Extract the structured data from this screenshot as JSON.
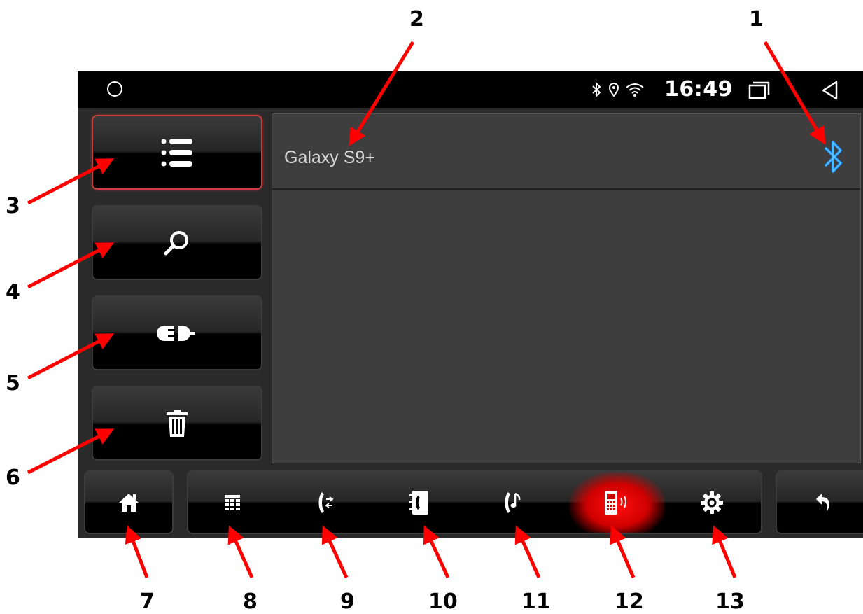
{
  "status_bar": {
    "time": "16:49",
    "icons": [
      "circle-home-icon",
      "bluetooth-icon",
      "location-icon",
      "wifi-icon",
      "recents-icon",
      "back-triangle-icon"
    ]
  },
  "device": {
    "name": "Galaxy S9+",
    "connection_icon": "bluetooth-icon",
    "connection_icon_color": "#1e90ff"
  },
  "side_buttons": [
    {
      "name": "paired-list",
      "icon": "list-icon",
      "selected": true
    },
    {
      "name": "search",
      "icon": "search-icon",
      "selected": false
    },
    {
      "name": "connect-disconnect",
      "icon": "plug-icon",
      "selected": false
    },
    {
      "name": "delete",
      "icon": "trash-icon",
      "selected": false
    }
  ],
  "bottom_bar": {
    "home_icon": "home-icon",
    "back_icon": "undo-arrow-icon",
    "tabs": [
      {
        "name": "dialpad",
        "icon": "keypad-icon",
        "active": false
      },
      {
        "name": "call-log",
        "icon": "call-log-icon",
        "active": false
      },
      {
        "name": "contacts",
        "icon": "contacts-book-icon",
        "active": false
      },
      {
        "name": "music",
        "icon": "phone-music-icon",
        "active": false
      },
      {
        "name": "devices",
        "icon": "phone-device-icon",
        "active": true
      },
      {
        "name": "settings",
        "icon": "gear-icon",
        "active": false
      }
    ]
  },
  "annotations": [
    "1",
    "2",
    "3",
    "4",
    "5",
    "6",
    "7",
    "8",
    "9",
    "10",
    "11",
    "12",
    "13"
  ],
  "colors": {
    "accent_red": "#e00000",
    "selected_border": "#c8413f",
    "arrow_red": "#ff0000"
  }
}
